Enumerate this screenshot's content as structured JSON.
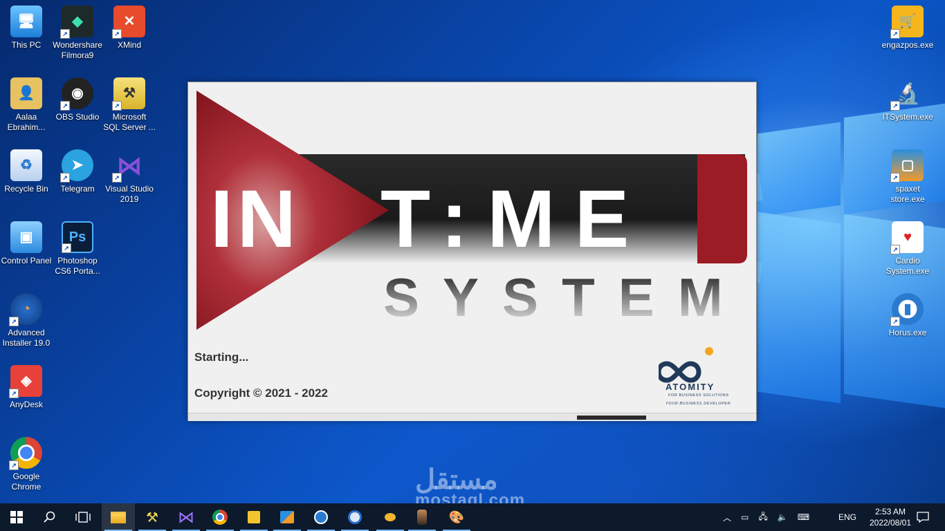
{
  "desktop": {
    "left_icons": [
      {
        "label": "This PC",
        "icon": "computer-icon"
      },
      {
        "label": "Wondershare Filmora9",
        "icon": "filmora-icon"
      },
      {
        "label": "XMind",
        "icon": "xmind-icon"
      },
      {
        "label": "Aalaa Ebrahim...",
        "icon": "user-folder-icon"
      },
      {
        "label": "OBS Studio",
        "icon": "obs-icon"
      },
      {
        "label": "Microsoft SQL Server ...",
        "icon": "sql-server-icon"
      },
      {
        "label": "Recycle Bin",
        "icon": "recycle-bin-icon"
      },
      {
        "label": "Telegram",
        "icon": "telegram-icon"
      },
      {
        "label": "Visual Studio 2019",
        "icon": "visual-studio-icon"
      },
      {
        "label": "Control Panel",
        "icon": "control-panel-icon"
      },
      {
        "label": "Photoshop CS6 Porta...",
        "icon": "photoshop-icon"
      },
      {
        "label": "Advanced Installer 19.0",
        "icon": "advanced-installer-icon"
      },
      {
        "label": "AnyDesk",
        "icon": "anydesk-icon"
      },
      {
        "label": "Google Chrome",
        "icon": "chrome-icon"
      }
    ],
    "right_icons": [
      {
        "label": "engazpos.exe",
        "icon": "cart-icon"
      },
      {
        "label": "ITSystem.exe",
        "icon": "microscope-icon"
      },
      {
        "label": "spaxet store.exe",
        "icon": "store-icon"
      },
      {
        "label": "Cardio System.exe",
        "icon": "heart-icon"
      },
      {
        "label": "Horus.exe",
        "icon": "chart-icon"
      }
    ]
  },
  "splash": {
    "logo_in": "IN",
    "logo_time": "T:ME",
    "logo_system": "SYSTEM",
    "status": "Starting...",
    "copyright": "Copyright © 2021 - 2022",
    "company_name": "ATOMITY",
    "company_sub": "FOR BUSINESS SOLUTIONS",
    "company_tag": "YOUR BUSINESS DEVELOPER",
    "progress": 0.12
  },
  "taskbar": {
    "buttons": [
      {
        "icon": "windows-start-icon"
      },
      {
        "icon": "search-icon"
      },
      {
        "icon": "task-view-icon"
      },
      {
        "icon": "file-explorer-icon"
      },
      {
        "icon": "sql-server-icon"
      },
      {
        "icon": "visual-studio-icon"
      },
      {
        "icon": "chrome-icon"
      },
      {
        "icon": "sticky-notes-icon"
      },
      {
        "icon": "spaxet-icon"
      },
      {
        "icon": "horus-icon"
      },
      {
        "icon": "app-icon"
      },
      {
        "icon": "splash-app-icon"
      },
      {
        "icon": "user-app-icon"
      },
      {
        "icon": "paint-icon"
      }
    ],
    "language": "ENG",
    "time": "2:53 AM",
    "date": "2022/08/01"
  },
  "watermark": {
    "line1": "مستقل",
    "line2": "mostaql.com"
  },
  "colors": {
    "accent_red": "#9b1c24",
    "taskbar": "#0c1a2c"
  }
}
